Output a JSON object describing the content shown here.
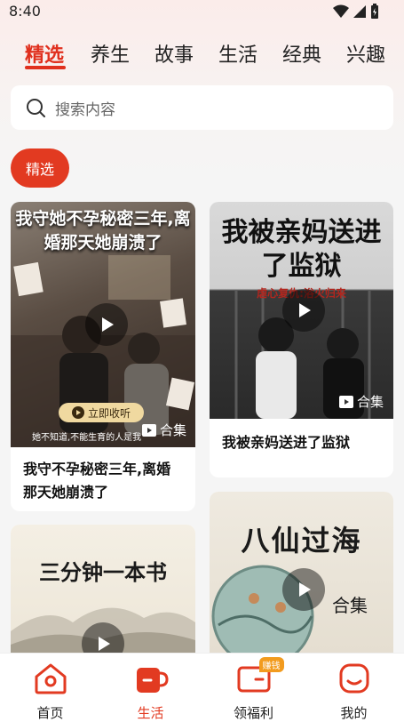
{
  "status_bar": {
    "time": "8:40"
  },
  "tabs": [
    {
      "label": "精选",
      "active": true
    },
    {
      "label": "养生"
    },
    {
      "label": "故事"
    },
    {
      "label": "生活"
    },
    {
      "label": "经典"
    },
    {
      "label": "兴趣"
    }
  ],
  "search": {
    "placeholder": "搜索内容"
  },
  "filter_chip": {
    "label": "精选"
  },
  "cards": [
    {
      "title": "我守不孕秘密三年,离婚那天她崩溃了",
      "cover_headline": "我守她不孕秘密三年,离婚那天她崩溃了",
      "cover_button": "立即收听",
      "cover_subtitle": "她不知道,不能生育的人是我",
      "collection_label": "合集"
    },
    {
      "title": "我被亲妈送进了监狱",
      "cover_headline": "我被亲妈送进了监狱",
      "cover_tagline": "虐心复仇:浴火归来",
      "collection_label": "合集"
    },
    {
      "cover_headline": "三分钟一本书"
    },
    {
      "cover_headline": "八仙过海",
      "collection_label": "合集"
    }
  ],
  "bottom_nav": [
    {
      "label": "首页",
      "icon": "home-icon"
    },
    {
      "label": "生活",
      "icon": "cup-icon",
      "active": true
    },
    {
      "label": "领福利",
      "icon": "wallet-icon",
      "badge": "赚钱"
    },
    {
      "label": "我的",
      "icon": "profile-icon"
    }
  ],
  "colors": {
    "accent": "#e0301e",
    "badge": "#f29b1e"
  }
}
